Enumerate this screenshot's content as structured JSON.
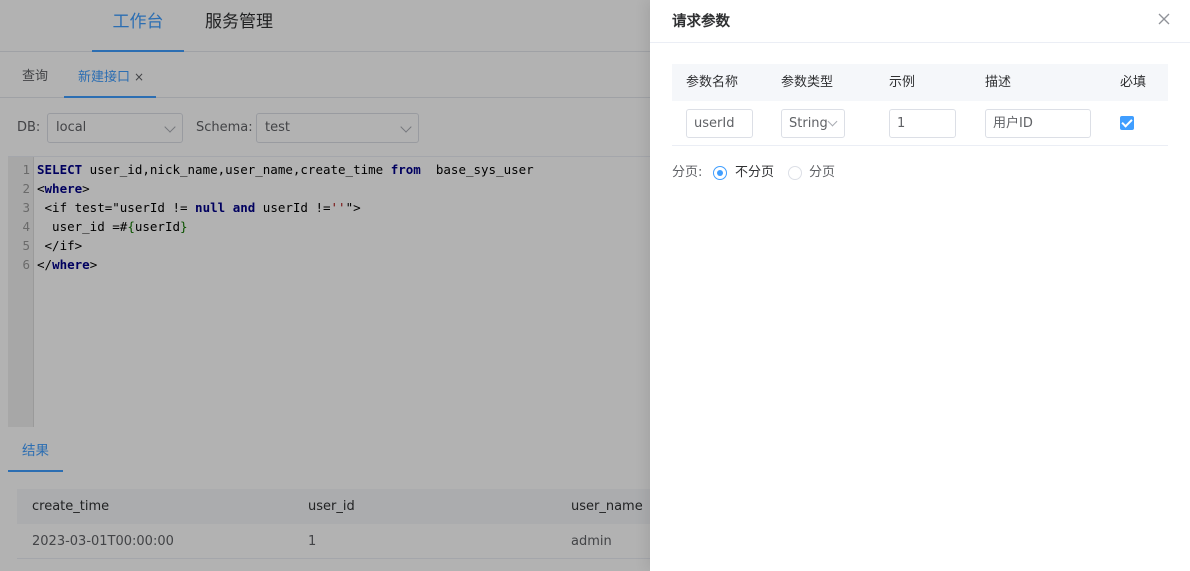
{
  "topnav": {
    "items": [
      {
        "label": "工作台",
        "active": true
      },
      {
        "label": "服务管理",
        "active": false
      }
    ]
  },
  "tabs": [
    {
      "label": "查询"
    },
    {
      "label": "新建接口",
      "closable": "×"
    }
  ],
  "connection": {
    "db_label": "DB:",
    "db_value": "local",
    "schema_label": "Schema:",
    "schema_value": "test"
  },
  "editor": {
    "line_numbers": [
      "1",
      "2",
      "3",
      "4",
      "5",
      "6"
    ]
  },
  "results": {
    "tab_label": "结果",
    "columns": [
      "create_time",
      "user_id",
      "user_name"
    ],
    "rows": [
      [
        "2023-03-01T00:00:00",
        "1",
        "admin"
      ]
    ]
  },
  "drawer": {
    "title": "请求参数",
    "columns": [
      "参数名称",
      "参数类型",
      "示例",
      "描述",
      "必填"
    ],
    "params": [
      {
        "name": "userId",
        "type": "String",
        "example": "1",
        "description": "用户ID",
        "required": true
      }
    ],
    "paging": {
      "label": "分页:",
      "options": [
        "不分页",
        "分页"
      ],
      "selected": "不分页"
    }
  },
  "colors": {
    "accent": "#409eff",
    "overlay": "rgba(0,0,0,0.30)"
  }
}
